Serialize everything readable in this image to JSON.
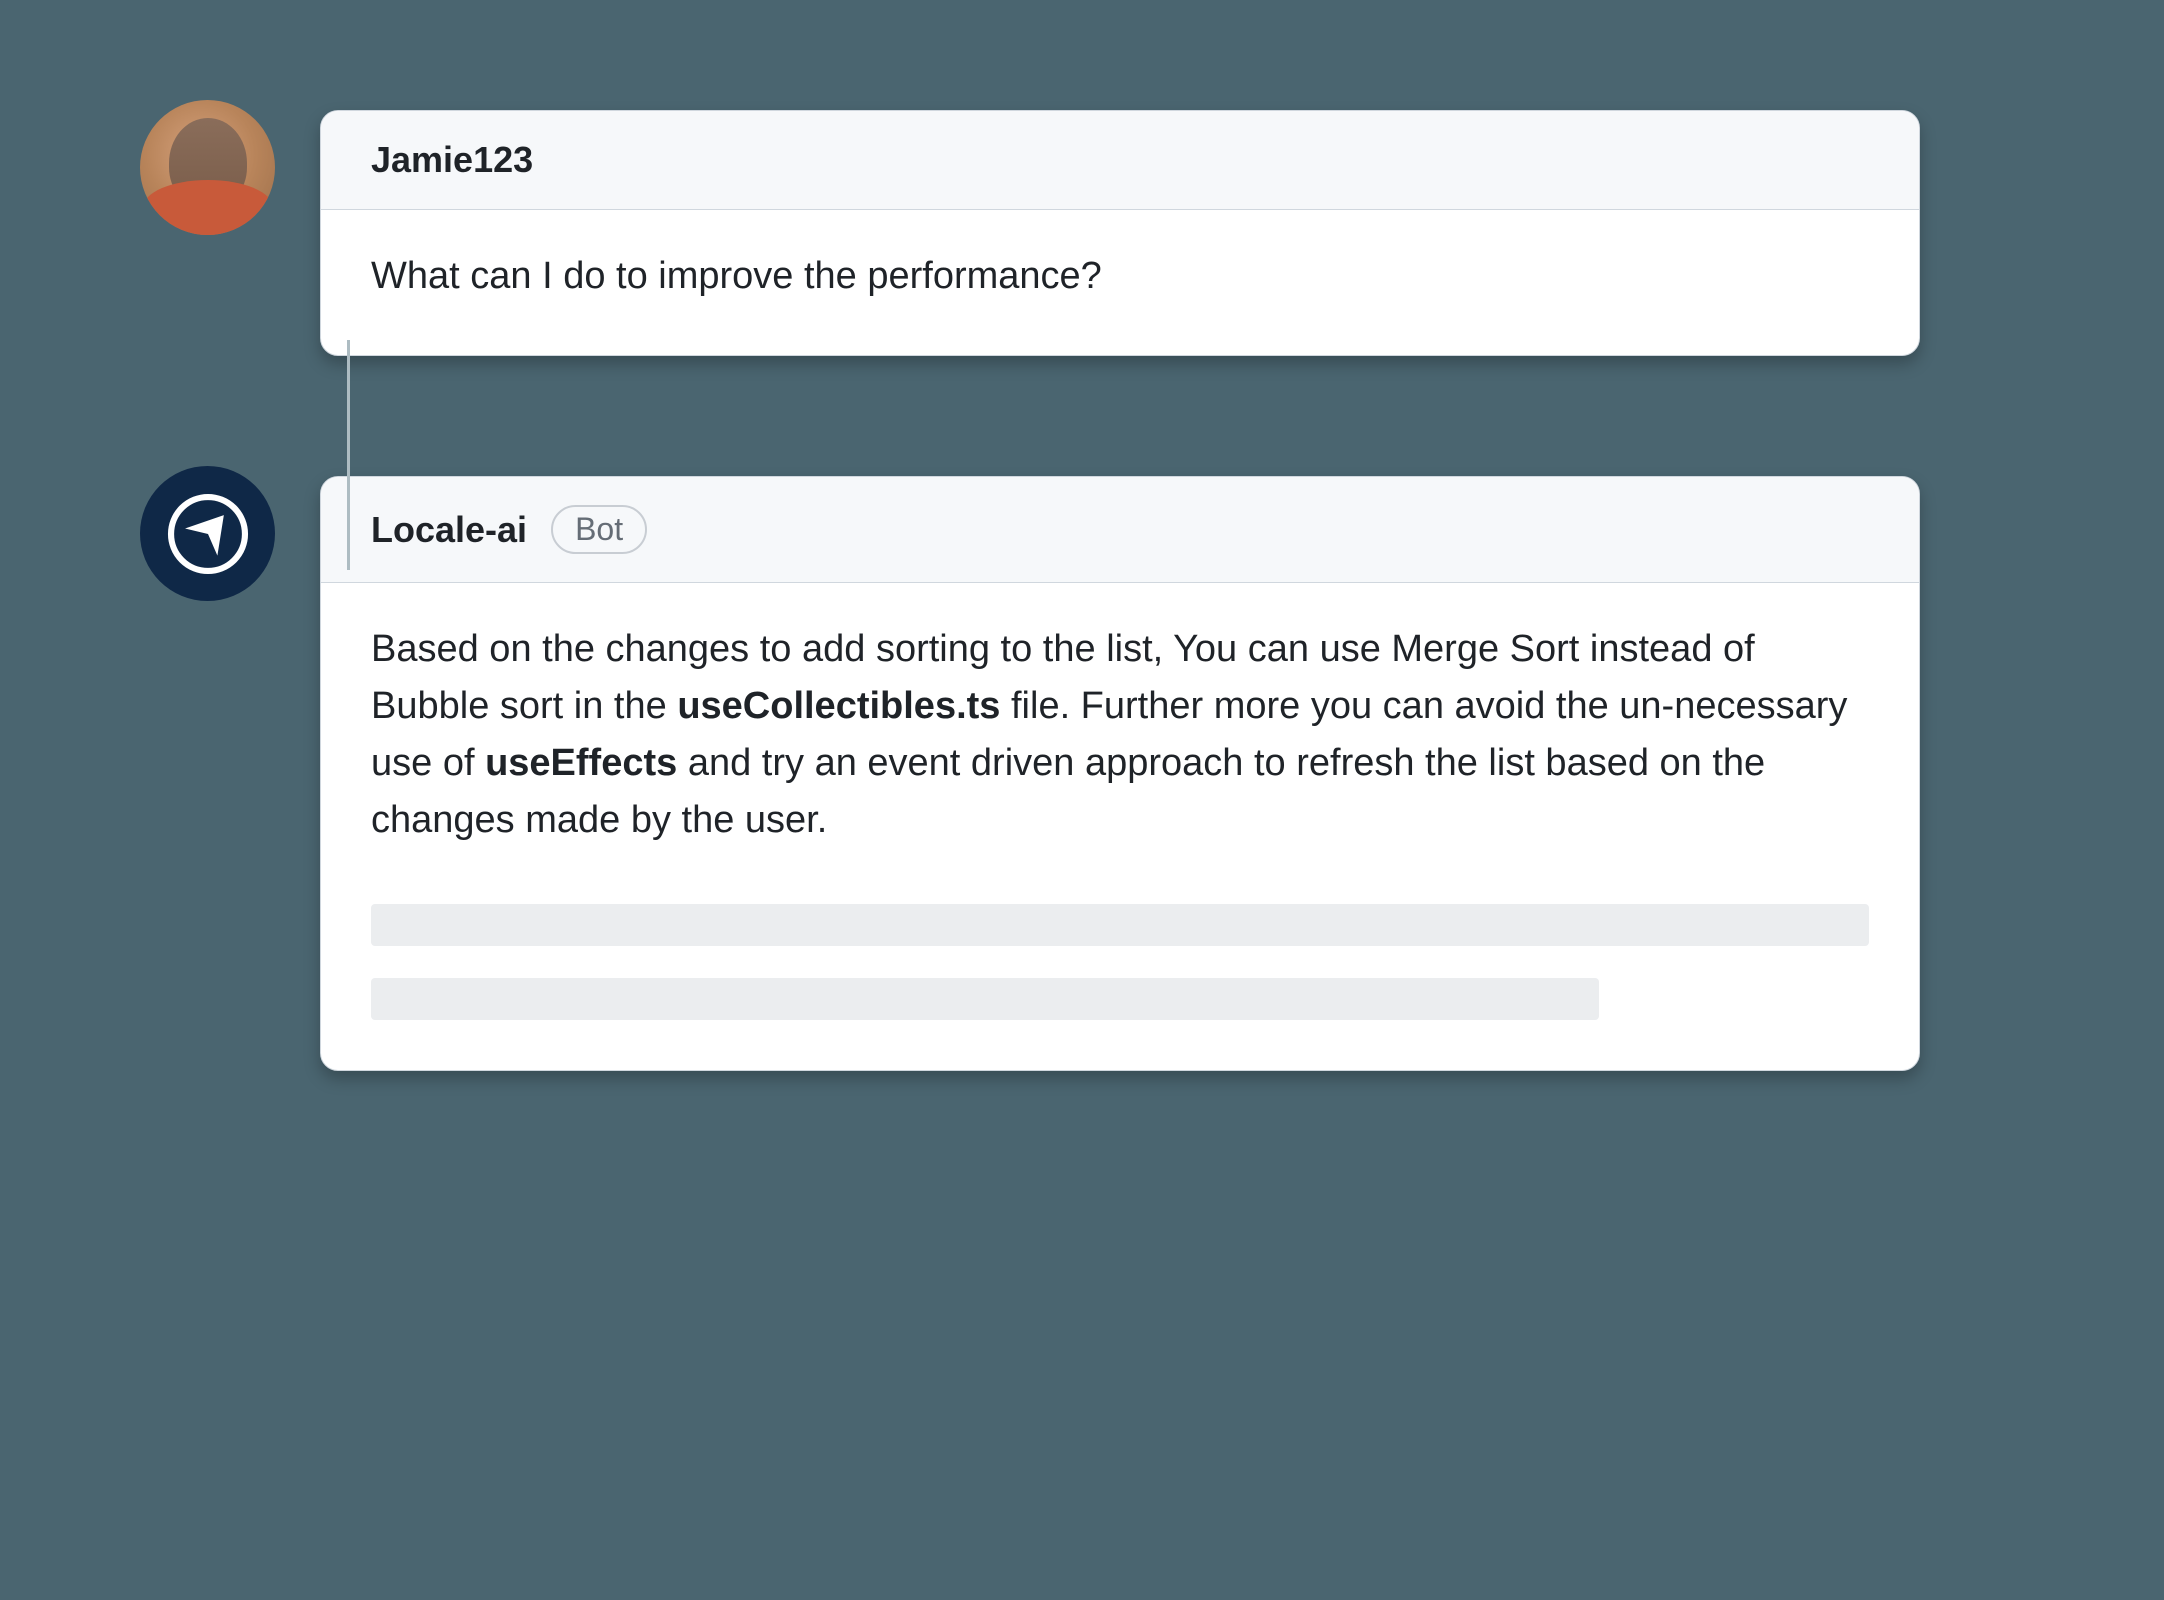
{
  "thread": {
    "user_message": {
      "author": "Jamie123",
      "body": "What can I do to improve the performance?"
    },
    "bot_message": {
      "author": "Locale-ai",
      "badge_label": "Bot",
      "body_parts": [
        {
          "text": "Based on the changes to add sorting to the list, You can use Merge Sort instead of Bubble sort in the ",
          "bold": false
        },
        {
          "text": "useCollectibles.ts",
          "bold": true
        },
        {
          "text": " file.  Further more you can avoid the un-necessary use of ",
          "bold": false
        },
        {
          "text": "useEffects",
          "bold": true
        },
        {
          "text": " and try an event driven approach to refresh the list based on the changes made by the user.",
          "bold": false
        }
      ]
    }
  }
}
